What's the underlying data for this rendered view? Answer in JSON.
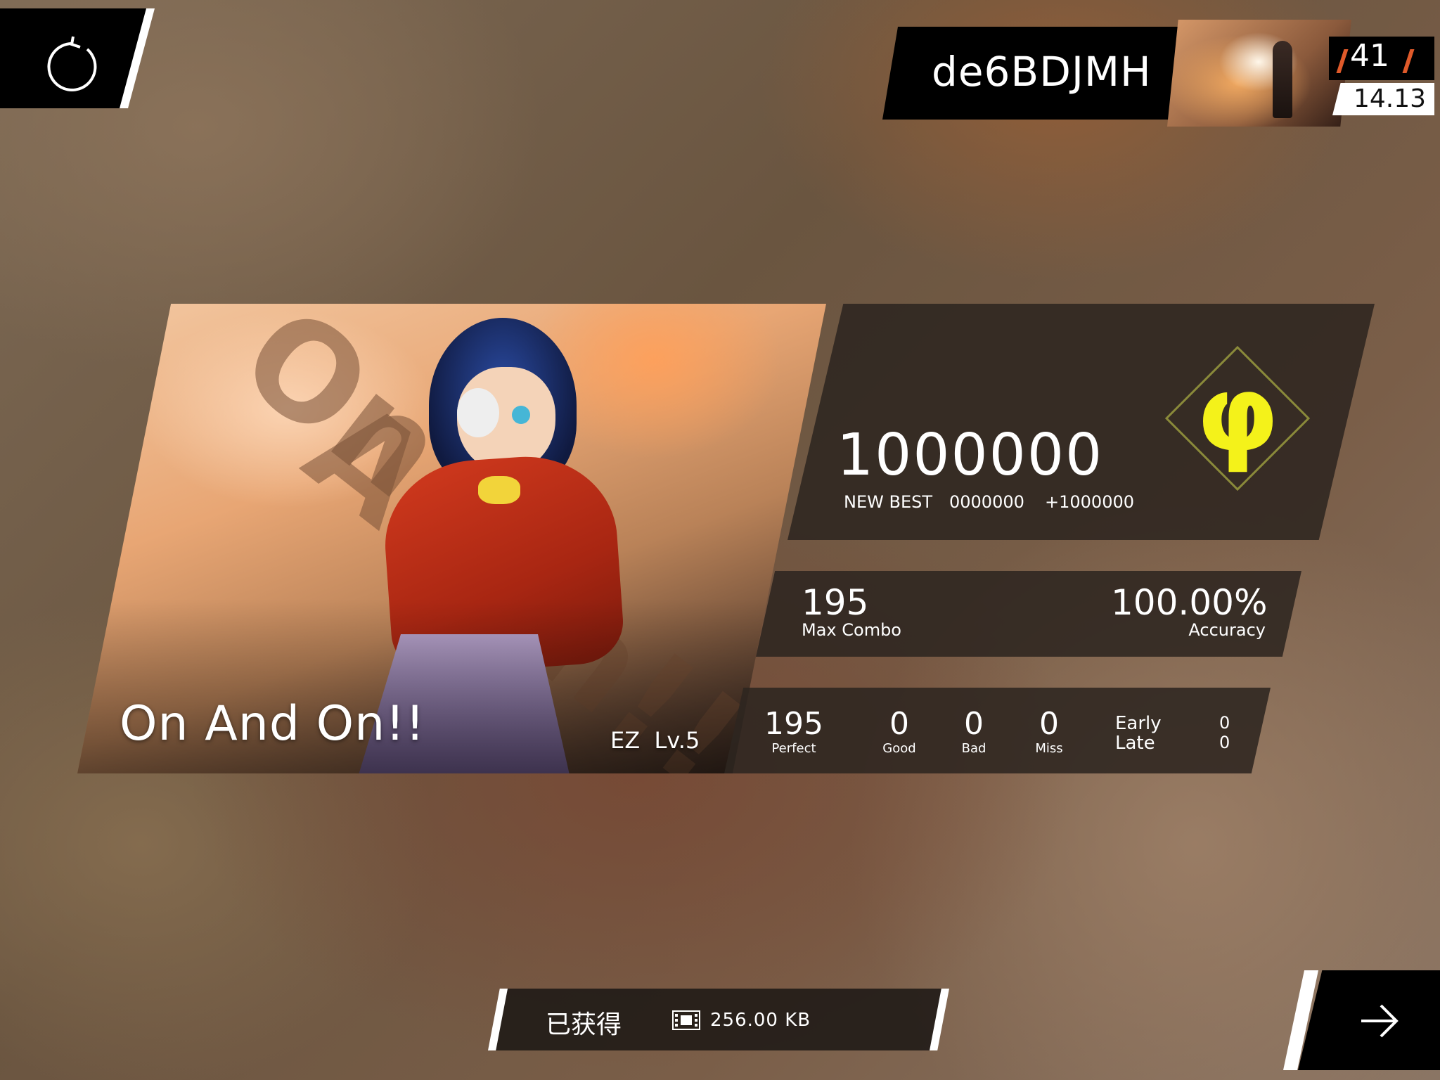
{
  "top_left": {
    "retry_icon": "retry-icon"
  },
  "player": {
    "name": "de6BDJMH",
    "rank": "41",
    "rks": "14.13",
    "avatar_icon": "avatar-image"
  },
  "song": {
    "title": "On And On!!",
    "difficulty": "EZ  Lv.5",
    "art_text": [
      "On",
      "And",
      "On!!"
    ]
  },
  "score": {
    "value": "1000000",
    "new_best_label": "NEW BEST",
    "previous": "0000000",
    "delta": "+1000000",
    "grade": "φ",
    "grade_color": "#f4f21a"
  },
  "stats": {
    "max_combo": "195",
    "max_combo_label": "Max Combo",
    "accuracy": "100.00%",
    "accuracy_label": "Accuracy"
  },
  "judgements": {
    "perfect": "195",
    "perfect_label": "Perfect",
    "good": "0",
    "good_label": "Good",
    "bad": "0",
    "bad_label": "Bad",
    "miss": "0",
    "miss_label": "Miss",
    "early_label": "Early",
    "early": "0",
    "late_label": "Late",
    "late": "0"
  },
  "reward": {
    "label": "已获得",
    "icon": "data-icon",
    "size": "256.00 KB"
  },
  "next": {
    "icon": "arrow-right-icon"
  }
}
